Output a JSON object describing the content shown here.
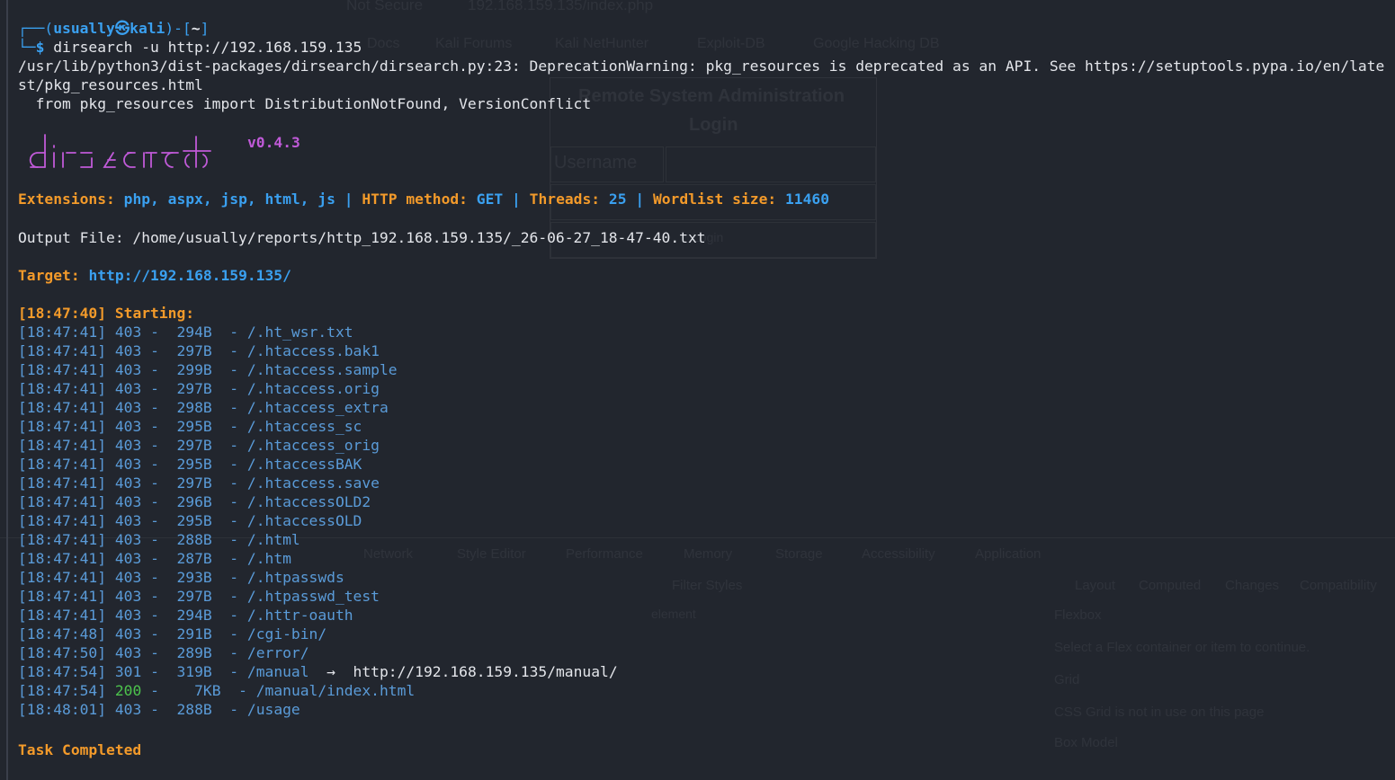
{
  "ghost": {
    "tab_title": "Not Secure",
    "url": "192.168.159.135/index.php",
    "bookmarks": [
      "Docs",
      "Kali Forums",
      "Kali NetHunter",
      "Exploit-DB",
      "Google Hacking DB"
    ],
    "login_title_1": "Remote System Administration",
    "login_title_2": "Login",
    "username_label": "Username",
    "login_button": "Login",
    "devtools_tabs": [
      "Network",
      "Style Editor",
      "Performance",
      "Memory",
      "Storage",
      "Accessibility",
      "Application"
    ],
    "panel_tabs": [
      "Layout",
      "Computed",
      "Changes",
      "Compatibility"
    ],
    "filter_styles": "Filter Styles",
    "element": "element",
    "flexbox": "Flexbox",
    "flex_hint": "Select a Flex container or item to continue.",
    "grid": "Grid",
    "grid_hint": "CSS Grid is not in use on this page",
    "box_model": "Box Model"
  },
  "terminal": {
    "prompt": {
      "user": "usually",
      "symbol": "㉿",
      "host": "kali",
      "path": "~",
      "command": "dirsearch -u http://192.168.159.135"
    },
    "warning_line1": "/usr/lib/python3/dist-packages/dirsearch/dirsearch.py:23: DeprecationWarning: pkg_resources is deprecated as an API. See https://setuptools.pypa.io/en/late",
    "warning_line2": "st/pkg_resources.html",
    "warning_line3": "  from pkg_resources import DistributionNotFound, VersionConflict",
    "version": "v0.4.3",
    "config": {
      "extensions_label": "Extensions:",
      "extensions_value": "php, aspx, jsp, html, js",
      "method_label": "HTTP method:",
      "method_value": "GET",
      "threads_label": "Threads:",
      "threads_value": "25",
      "wordlist_label": "Wordlist size:",
      "wordlist_value": "11460"
    },
    "output_file": "Output File: /home/usually/reports/http_192.168.159.135/_26-06-27_18-47-40.txt",
    "target_label": "Target:",
    "target_value": "http://192.168.159.135/",
    "starting_time": "[18:47:40]",
    "starting_label": "Starting:",
    "results": [
      {
        "time": "[18:47:41]",
        "status": "403",
        "size": " 294B",
        "path": "/.ht_wsr.txt",
        "redirect": ""
      },
      {
        "time": "[18:47:41]",
        "status": "403",
        "size": " 297B",
        "path": "/.htaccess.bak1",
        "redirect": ""
      },
      {
        "time": "[18:47:41]",
        "status": "403",
        "size": " 299B",
        "path": "/.htaccess.sample",
        "redirect": ""
      },
      {
        "time": "[18:47:41]",
        "status": "403",
        "size": " 297B",
        "path": "/.htaccess.orig",
        "redirect": ""
      },
      {
        "time": "[18:47:41]",
        "status": "403",
        "size": " 298B",
        "path": "/.htaccess_extra",
        "redirect": ""
      },
      {
        "time": "[18:47:41]",
        "status": "403",
        "size": " 295B",
        "path": "/.htaccess_sc",
        "redirect": ""
      },
      {
        "time": "[18:47:41]",
        "status": "403",
        "size": " 297B",
        "path": "/.htaccess_orig",
        "redirect": ""
      },
      {
        "time": "[18:47:41]",
        "status": "403",
        "size": " 295B",
        "path": "/.htaccessBAK",
        "redirect": ""
      },
      {
        "time": "[18:47:41]",
        "status": "403",
        "size": " 297B",
        "path": "/.htaccess.save",
        "redirect": ""
      },
      {
        "time": "[18:47:41]",
        "status": "403",
        "size": " 296B",
        "path": "/.htaccessOLD2",
        "redirect": ""
      },
      {
        "time": "[18:47:41]",
        "status": "403",
        "size": " 295B",
        "path": "/.htaccessOLD",
        "redirect": ""
      },
      {
        "time": "[18:47:41]",
        "status": "403",
        "size": " 288B",
        "path": "/.html",
        "redirect": ""
      },
      {
        "time": "[18:47:41]",
        "status": "403",
        "size": " 287B",
        "path": "/.htm",
        "redirect": ""
      },
      {
        "time": "[18:47:41]",
        "status": "403",
        "size": " 293B",
        "path": "/.htpasswds",
        "redirect": ""
      },
      {
        "time": "[18:47:41]",
        "status": "403",
        "size": " 297B",
        "path": "/.htpasswd_test",
        "redirect": ""
      },
      {
        "time": "[18:47:41]",
        "status": "403",
        "size": " 294B",
        "path": "/.httr-oauth",
        "redirect": ""
      },
      {
        "time": "[18:47:48]",
        "status": "403",
        "size": " 291B",
        "path": "/cgi-bin/",
        "redirect": ""
      },
      {
        "time": "[18:47:50]",
        "status": "403",
        "size": " 289B",
        "path": "/error/",
        "redirect": ""
      },
      {
        "time": "[18:47:54]",
        "status": "301",
        "size": " 319B",
        "path": "/manual",
        "redirect": "  →  http://192.168.159.135/manual/"
      },
      {
        "time": "[18:47:54]",
        "status": "200",
        "size": "   7KB",
        "path": "/manual/index.html",
        "redirect": ""
      },
      {
        "time": "[18:48:01]",
        "status": "403",
        "size": " 288B",
        "path": "/usage",
        "redirect": ""
      }
    ],
    "completed": "Task Completed"
  },
  "colors": {
    "background": "#22262e",
    "blue": "#3aa0f0",
    "orange": "#f39a2a",
    "purple": "#c05ad8",
    "text": "#e3e5ea"
  },
  "icons": [
    "dirsearch-ascii-logo"
  ]
}
